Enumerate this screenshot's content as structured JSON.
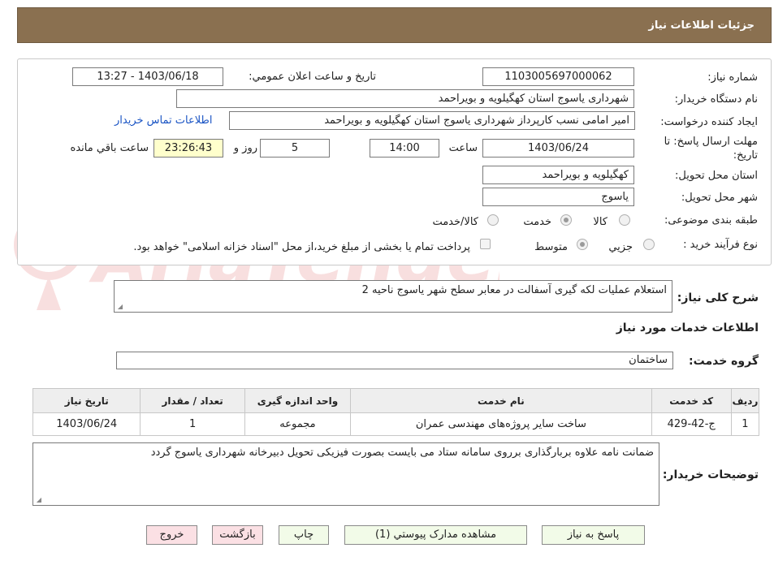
{
  "header": {
    "title": "جزئیات اطلاعات نیاز"
  },
  "form": {
    "need_number_label": "شماره نیاز:",
    "need_number": "1103005697000062",
    "announce_label": "تاریخ و ساعت اعلان عمومي:",
    "announce_value": "1403/06/18 - 13:27",
    "buyer_label": "نام دستگاه خريدار:",
    "buyer_value": "شهرداری یاسوج استان کهگیلویه و بویراحمد",
    "creator_label": "ايجاد کننده درخواست:",
    "creator_value": "امیر امامی نسب کارپرداز شهرداری یاسوج استان کهگیلویه و بویراحمد",
    "contact_link": "اطلاعات تماس خريدار",
    "deadline_label": "مهلت ارسال پاسخ: تا تاریخ:",
    "deadline_date": "1403/06/24",
    "time_label": "ساعت",
    "deadline_time": "14:00",
    "days_value": "5",
    "days_label": "روز و",
    "remaining_time": "23:26:43",
    "remaining_label": "ساعت باقي مانده",
    "province_label": "استان محل تحويل:",
    "province_value": "کهگیلویه و بویراحمد",
    "city_label": "شهر محل تحويل:",
    "city_value": "یاسوج",
    "category_label": "طبقه بندی موضوعی:",
    "category_options": [
      "کالا",
      "خدمت",
      "کالا/خدمت"
    ],
    "process_label": "نوع فرآيند خريد :",
    "process_options": [
      "جزيي",
      "متوسط"
    ],
    "payment_note": "پرداخت تمام يا بخشی از مبلغ خريد،از محل \"اسناد خزانه اسلامی\" خواهد بود."
  },
  "description": {
    "label": "شرح کلی نیاز:",
    "value": "استعلام عملیات لکه گیری آسفالت در معابر سطح شهر یاسوج ناحیه 2"
  },
  "services": {
    "section_title": "اطلاعات خدمات مورد نياز",
    "group_label": "گروه خدمت:",
    "group_value": "ساختمان",
    "columns": [
      "رديف",
      "کد خدمت",
      "نام خدمت",
      "واحد اندازه گيری",
      "تعداد / مقدار",
      "تاريخ نياز"
    ],
    "rows": [
      [
        "1",
        "ج-42-429",
        "ساخت سایر پروژه‌های مهندسی عمران",
        "مجموعه",
        "1",
        "1403/06/24"
      ]
    ]
  },
  "buyer_notes": {
    "label": "توضيحات خريدار:",
    "value": "ضمانت نامه علاوه بربارگذاری برروی سامانه ستاد می بایست بصورت فیزیکی تحویل دبیرخانه شهرداری یاسوج گردد"
  },
  "buttons": {
    "reply": "پاسخ به نياز",
    "attachments": "مشاهده مدارک پيوستي (1)",
    "print": "چاپ",
    "back": "بازگشت",
    "exit": "خروج"
  },
  "watermark": {
    "text": "AriaTender.net"
  },
  "colors": {
    "header_bg": "#8a7050",
    "link": "#1a54c4",
    "button_green": "#f2fbe8",
    "button_pink": "#fbe0e4",
    "remaining_bg": "#ffffcc"
  }
}
